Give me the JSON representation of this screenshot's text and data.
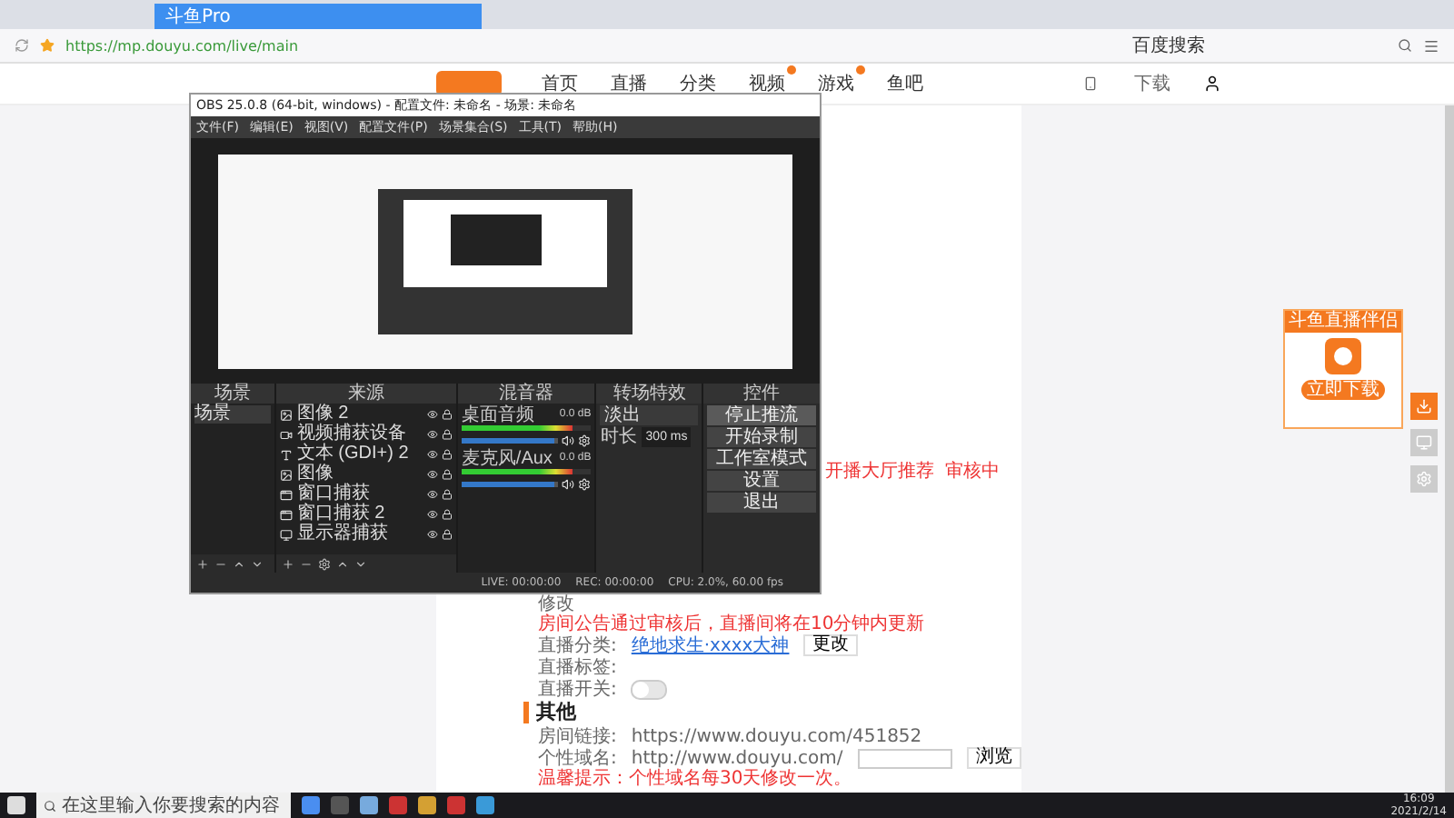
{
  "browser": {
    "tabs": [
      {
        "title": "斗鱼Pro",
        "selected": true
      }
    ],
    "url": "https://mp.douyu.com/live/main",
    "search": "百度搜索"
  },
  "site_nav": {
    "items": [
      {
        "label": "首页",
        "badge": false
      },
      {
        "label": "直播",
        "badge": false
      },
      {
        "label": "分类",
        "badge": false
      },
      {
        "label": "视频",
        "badge": true
      },
      {
        "label": "游戏",
        "badge": true
      },
      {
        "label": "鱼吧",
        "badge": false
      }
    ],
    "download": "下载"
  },
  "obs": {
    "title": "OBS 25.0.8 (64-bit, windows) - 配置文件: 未命名 - 场景: 未命名",
    "menu": [
      "文件(F)",
      "编辑(E)",
      "视图(V)",
      "配置文件(P)",
      "场景集合(S)",
      "工具(T)",
      "帮助(H)"
    ],
    "docks": [
      "场景",
      "来源",
      "混音器",
      "转场特效",
      "控件"
    ],
    "scenes": [
      {
        "name": "场景",
        "selected": true
      }
    ],
    "sources": [
      {
        "name": "图像 2",
        "kind": "image"
      },
      {
        "name": "视频捕获设备",
        "kind": "camera"
      },
      {
        "name": "文本 (GDI+) 2",
        "kind": "text"
      },
      {
        "name": "图像",
        "kind": "image"
      },
      {
        "name": "窗口捕获",
        "kind": "window"
      },
      {
        "name": "窗口捕获 2",
        "kind": "window"
      },
      {
        "name": "显示器捕获",
        "kind": "monitor"
      }
    ],
    "mixer": [
      {
        "name": "桌面音频",
        "reading": "0.0 dB",
        "meter": {
          "level": 0.85
        },
        "fader": {
          "level": 0.95
        }
      },
      {
        "name": "麦克风/Aux",
        "reading": "0.0 dB",
        "meter": {
          "level": 0.85
        },
        "fader": {
          "level": 0.95
        }
      }
    ],
    "transition": {
      "value": "淡出",
      "duration_label": "时长",
      "duration": "300 ms"
    },
    "controls": [
      {
        "label": "停止推流",
        "active": true
      },
      {
        "label": "开始录制",
        "active": false
      },
      {
        "label": "工作室模式",
        "active": false
      },
      {
        "label": "设置",
        "active": false
      },
      {
        "label": "退出",
        "active": false
      }
    ],
    "status": [
      "LIVE: 00:00:00",
      "REC: 00:00:00",
      "CPU: 2.0%, 60.00 fps"
    ]
  },
  "form": {
    "review_note": "开播大厅推荐",
    "review_state": "审核中",
    "edit": "修改",
    "notice": "房间公告通过审核后，直播间将在10分钟内更新",
    "rows": [
      {
        "label": "直播分类:",
        "link": "绝地求生·xxxx大神",
        "button": "更改"
      },
      {
        "label": "直播标签:"
      },
      {
        "label": "直播开关:",
        "toggle": false
      }
    ],
    "section": "其他",
    "room_label": "房间链接:",
    "room_url": "https://www.douyu.com/451852",
    "domain_label": "个性域名:",
    "domain_prefix": "http://www.douyu.com/",
    "domain_button": "浏览",
    "domain_note": "温馨提示：个性域名每30天修改一次。"
  },
  "ad": {
    "title": "斗鱼直播伴侣",
    "button": "立即下载"
  },
  "taskbar": {
    "search_placeholder": "在这里输入你要搜索的内容",
    "time": "16:09",
    "date": "2021/2/14"
  }
}
